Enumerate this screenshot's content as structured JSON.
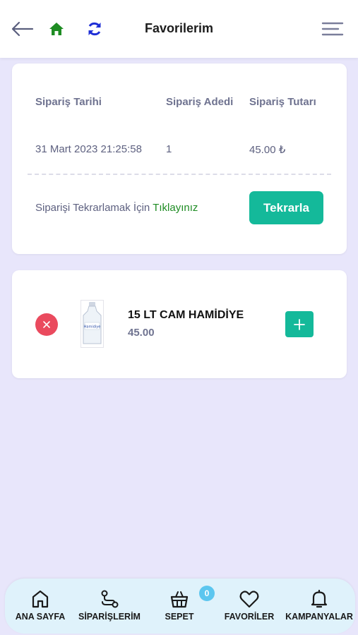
{
  "header": {
    "title": "Favorilerim",
    "icons": [
      "back-arrow-icon",
      "home-icon",
      "refresh-icon",
      "menu-icon"
    ],
    "home_color": "#1e8c23",
    "refresh_color": "#1f2fd6"
  },
  "order": {
    "headers": {
      "date": "Sipariş Tarihi",
      "count": "Sipariş Adedi",
      "amount": "Sipariş Tutarı"
    },
    "values": {
      "date": "31 Mart 2023 21:25:58",
      "count": "1",
      "amount": "45.00 ₺"
    },
    "repeat_text": "Siparişi Tekrarlamak İçin",
    "repeat_link": "Tıklayınız",
    "repeat_button": "Tekrarla"
  },
  "product": {
    "name": "15 LT CAM HAMİDİYE",
    "price": "45.00",
    "image_label": "Hamidiye"
  },
  "bottom_nav": {
    "items": [
      {
        "label": "ANA SAYFA",
        "icon": "home-outline-icon"
      },
      {
        "label": "SİPARİŞLERİM",
        "icon": "route-icon"
      },
      {
        "label": "SEPET",
        "icon": "basket-icon"
      },
      {
        "label": "FAVORİLER",
        "icon": "heart-icon"
      },
      {
        "label": "KAMPANYALAR",
        "icon": "bell-icon"
      }
    ],
    "cart_badge": "0"
  },
  "colors": {
    "accent": "#14b99a",
    "danger": "#ea4a5e",
    "background": "#e8e6fb",
    "nav_background": "#dff2fb",
    "badge": "#5cc6ef"
  }
}
